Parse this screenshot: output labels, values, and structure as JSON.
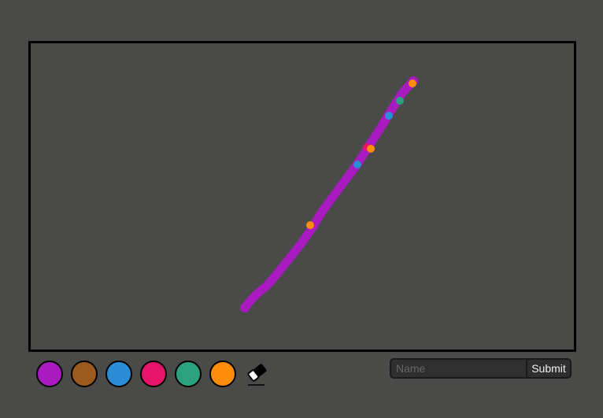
{
  "palette": {
    "colors": [
      {
        "name": "purple",
        "hex": "#a91bc0"
      },
      {
        "name": "brown",
        "hex": "#9c5a1f"
      },
      {
        "name": "blue",
        "hex": "#2b8dd6"
      },
      {
        "name": "pink",
        "hex": "#e8136a"
      },
      {
        "name": "green",
        "hex": "#2ba17e"
      },
      {
        "name": "orange",
        "hex": "#ff8c0a"
      }
    ],
    "eraser_icon": "eraser-icon"
  },
  "form": {
    "name_placeholder": "Name",
    "name_value": "",
    "submit_label": "Submit"
  },
  "drawing": {
    "stroke_color": "#a91bc0",
    "dot_colors": [
      "#ff8c0a",
      "#2ba17e",
      "#2b8dd6",
      "#e8136a",
      "#ff8c0a",
      "#2b8dd6",
      "#ff8c0a"
    ]
  }
}
